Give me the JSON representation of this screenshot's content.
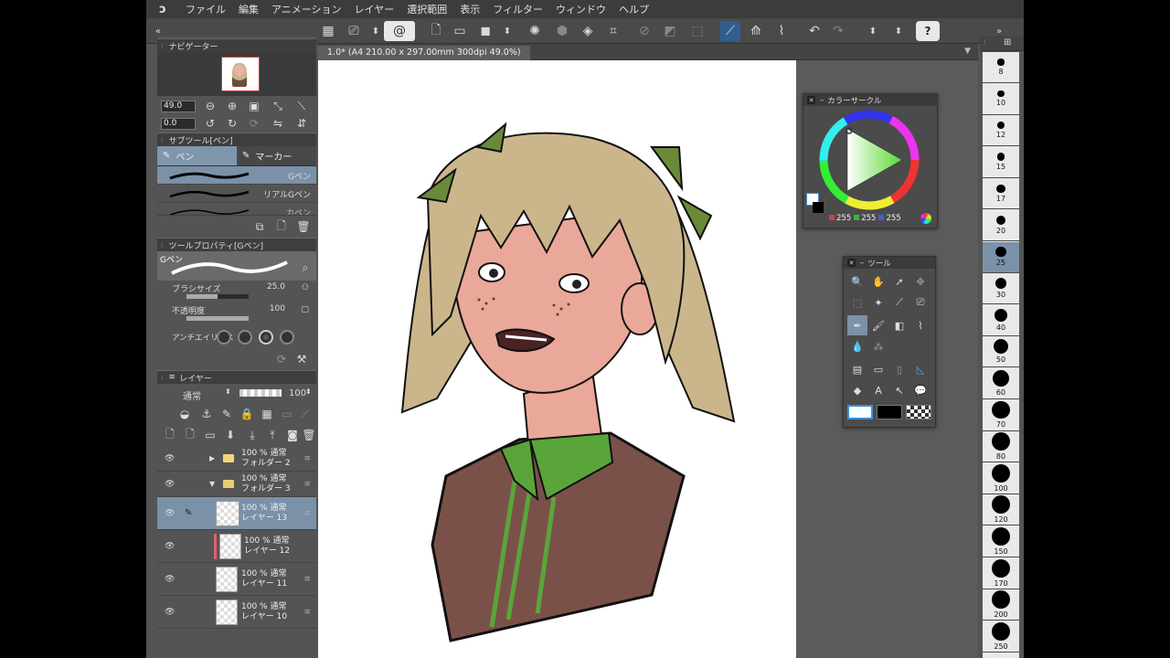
{
  "menu": {
    "logo": "ↄ",
    "items": [
      "ファイル",
      "編集",
      "アニメーション",
      "レイヤー",
      "選択範囲",
      "表示",
      "フィルター",
      "ウィンドウ",
      "ヘルプ"
    ]
  },
  "toolbar": {
    "help_label": "?"
  },
  "navigator": {
    "title": "ナビゲーター",
    "zoom_value": "49.0",
    "rotate_value": "0.0"
  },
  "subtool": {
    "title": "サブツール[ペン]",
    "tabs": [
      "ペン",
      "マーカー"
    ],
    "brushes": [
      "Gペン",
      "リアルGペン",
      "カペン"
    ]
  },
  "tool_property": {
    "title": "ツールプロパティ[Gペン]",
    "brush_name": "Gペン",
    "brush_size_label": "ブラシサイズ",
    "brush_size_value": "25.0",
    "brush_size_fraction": 0.5,
    "opacity_label": "不透明度",
    "opacity_value": "100",
    "opacity_fraction": 1.0,
    "antialias_label": "アンチエイリアス"
  },
  "layers": {
    "title": "レイヤー",
    "blend_mode": "通常",
    "opacity": "100",
    "rows": [
      {
        "line1": "100 % 通常",
        "line2": "フォルダー 2",
        "type": "folder",
        "expanded": false
      },
      {
        "line1": "100 % 通常",
        "line2": "フォルダー 3",
        "type": "folder",
        "expanded": true
      },
      {
        "line1": "100 % 通常",
        "line2": "レイヤー 13",
        "type": "layer",
        "selected": true
      },
      {
        "line1": "100 % 通常",
        "line2": "レイヤー 12",
        "type": "layer"
      },
      {
        "line1": "100 % 通常",
        "line2": "レイヤー 11",
        "type": "layer"
      },
      {
        "line1": "100 % 通常",
        "line2": "レイヤー 10",
        "type": "layer"
      }
    ]
  },
  "document": {
    "tab_title": "1.0* (A4 210.00 x 297.00mm 300dpi 49.0%)"
  },
  "color_circle": {
    "title": "カラーサークル",
    "r": "255",
    "g": "255",
    "b": "255",
    "r_color": "#d04040",
    "g_color": "#40b040",
    "b_color": "#4060d0"
  },
  "tool_palette": {
    "title": "ツール"
  },
  "brush_sizes": [
    "8",
    "10",
    "12",
    "15",
    "17",
    "20",
    "25",
    "30",
    "40",
    "50",
    "60",
    "70",
    "80",
    "100",
    "120",
    "150",
    "170",
    "200",
    "250"
  ],
  "selected_brush_size": "25"
}
